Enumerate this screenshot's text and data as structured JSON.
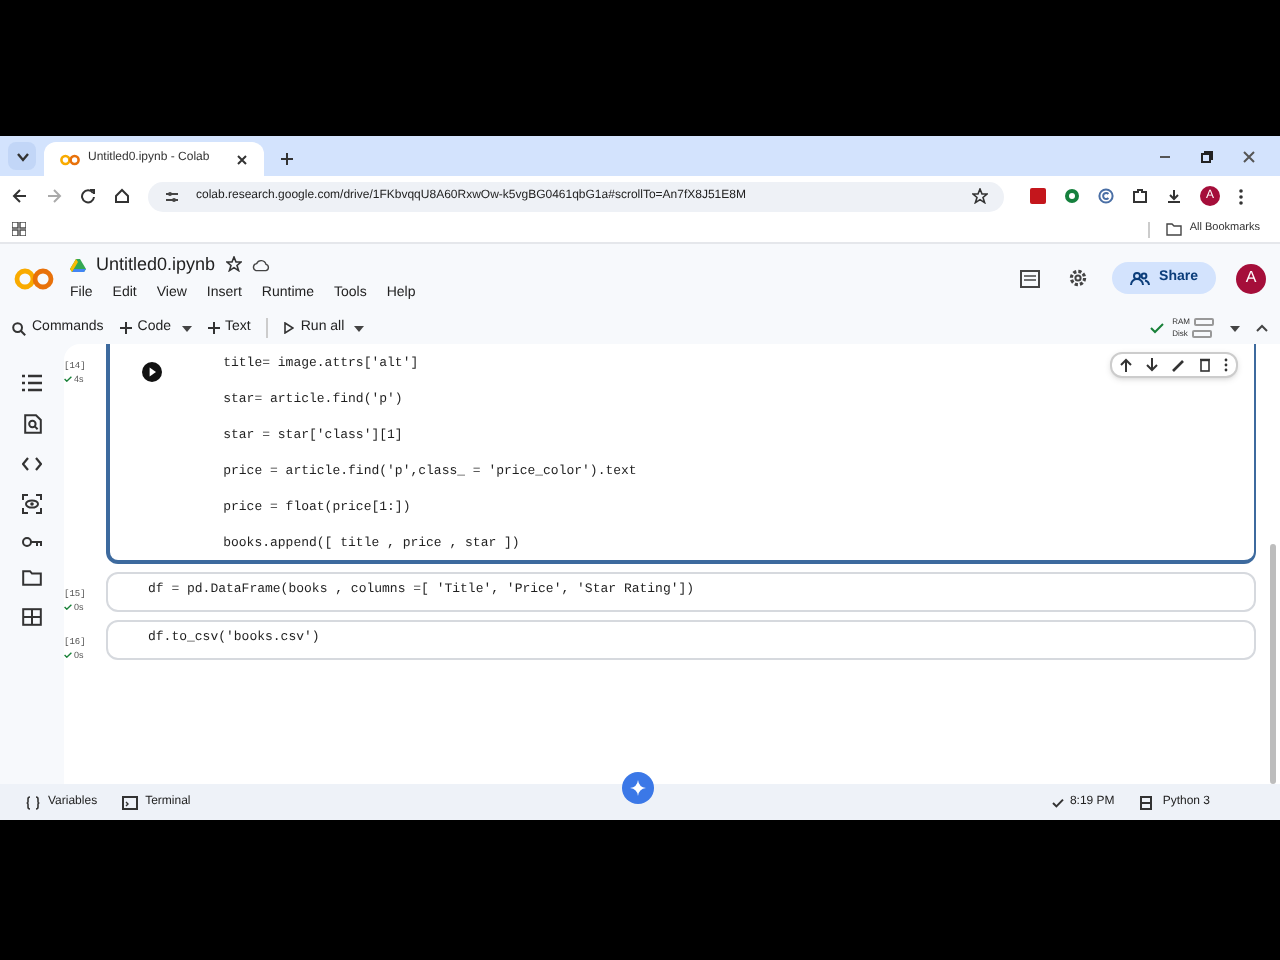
{
  "browser": {
    "tab_title": "Untitled0.ipynb - Colab",
    "url": "colab.research.google.com/drive/1FKbvqqU8A60RxwOw-k5vgBG0461qbG1a#scrollTo=An7fX8J51E8M",
    "bookmarks_label": "All Bookmarks",
    "profile_initial": "A"
  },
  "notebook": {
    "title": "Untitled0.ipynb",
    "menu": [
      "File",
      "Edit",
      "View",
      "Insert",
      "Runtime",
      "Tools",
      "Help"
    ],
    "share_label": "Share",
    "avatar_initial": "A"
  },
  "toolbar": {
    "items": [
      {
        "label": "Commands",
        "kind": "search"
      },
      {
        "label": "Code",
        "kind": "add"
      },
      {
        "label": "Text",
        "kind": "add"
      },
      {
        "label": "Run all",
        "kind": "run"
      }
    ],
    "ram_label": "RAM",
    "disk_label": "Disk"
  },
  "cells": [
    {
      "count": "[14]",
      "duration": "4s",
      "selected": true,
      "lines": [
        "    title= image.attrs['alt']",
        "    star= article.find('p')",
        "    star = star['class'][1]",
        "    price = article.find('p',class_ = 'price_color').text",
        "    price = float(price[1:])",
        "    books.append([ title , price , star ])"
      ]
    },
    {
      "count": "[15]",
      "duration": "0s",
      "selected": false,
      "lines": [
        "df = pd.DataFrame(books , columns =[ 'Title', 'Price', 'Star Rating'])"
      ]
    },
    {
      "count": "[16]",
      "duration": "0s",
      "selected": false,
      "lines": [
        "df.to_csv('books.csv')"
      ]
    }
  ],
  "status_bar": {
    "items": [
      {
        "label": "Variables",
        "kind": "braces"
      },
      {
        "label": "Terminal",
        "kind": "terminal"
      }
    ],
    "time": "8:19 PM",
    "runtime": "Python 3"
  }
}
